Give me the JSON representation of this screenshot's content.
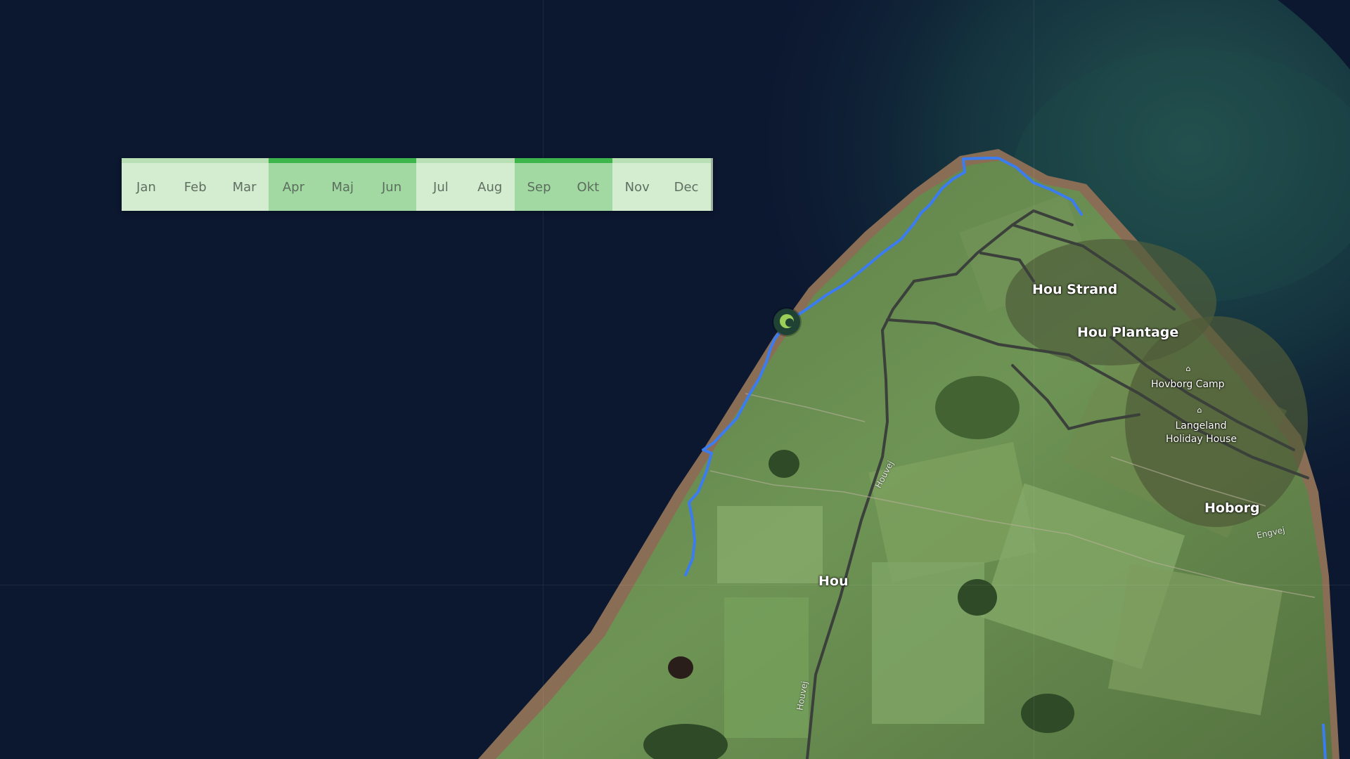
{
  "months": [
    {
      "label": "Jan",
      "active": false
    },
    {
      "label": "Feb",
      "active": false
    },
    {
      "label": "Mar",
      "active": false
    },
    {
      "label": "Apr",
      "active": true
    },
    {
      "label": "Maj",
      "active": true
    },
    {
      "label": "Jun",
      "active": true
    },
    {
      "label": "Jul",
      "active": false
    },
    {
      "label": "Aug",
      "active": false
    },
    {
      "label": "Sep",
      "active": true
    },
    {
      "label": "Okt",
      "active": true
    },
    {
      "label": "Nov",
      "active": false
    },
    {
      "label": "Dec",
      "active": false
    }
  ],
  "map": {
    "places": {
      "hou_strand": "Hou Strand",
      "hou_plantage": "Hou Plantage",
      "hoborg": "Hoborg",
      "hou": "Hou"
    },
    "pois": {
      "hovborg_camp": "Hovborg Camp",
      "langeland_line1": "Langeland",
      "langeland_line2": "Holiday House"
    },
    "roads": {
      "houvej_1": "Houvej",
      "houvej_2": "Houvej",
      "engvej": "Engvej"
    }
  },
  "colors": {
    "route": "#3b7cf0",
    "month_active": "#a2d9a2",
    "month_inactive": "#d4ecd0",
    "sea": "#0c1730"
  }
}
